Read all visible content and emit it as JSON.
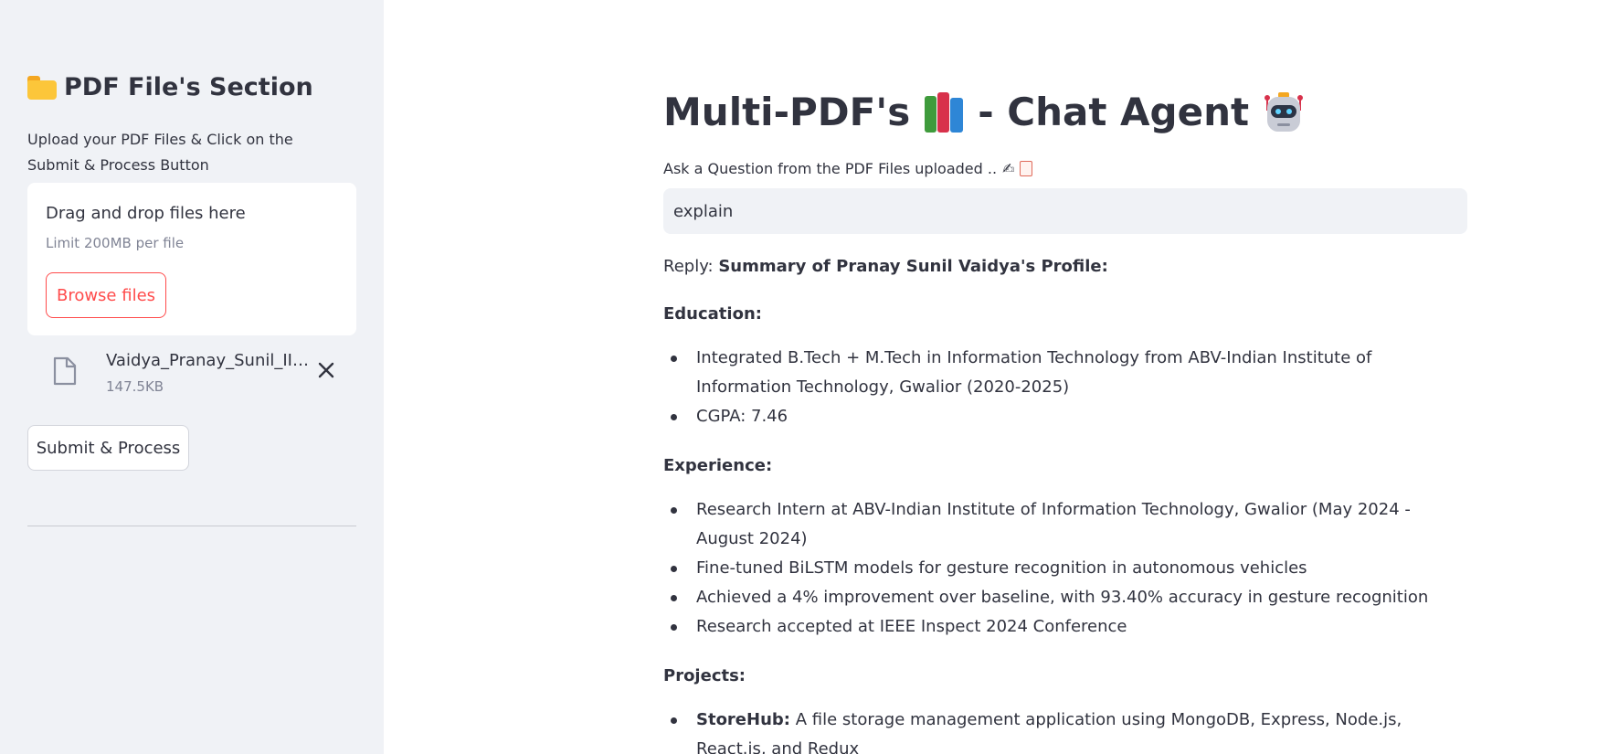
{
  "sidebar": {
    "title": "PDF File's Section",
    "description": "Upload your PDF Files & Click on the Submit & Process Button",
    "uploader": {
      "drag_text": "Drag and drop files here",
      "limit_text": "Limit 200MB per file",
      "browse_label": "Browse files"
    },
    "file": {
      "name": "Vaidya_Pranay_Sunil_III...",
      "size": "147.5KB"
    },
    "submit_label": "Submit & Process"
  },
  "main": {
    "title_part1": "Multi-PDF's",
    "title_part2": "- Chat Agent",
    "ask_label": "Ask a Question from the PDF Files uploaded ..",
    "input_value": "explain",
    "reply_prefix": "Reply:",
    "reply_heading": "Summary of Pranay Sunil Vaidya's Profile:",
    "sections": {
      "education": {
        "heading": "Education:",
        "items": [
          "Integrated B.Tech + M.Tech in Information Technology from ABV-Indian Institute of Information Technology, Gwalior (2020-2025)",
          "CGPA: 7.46"
        ]
      },
      "experience": {
        "heading": "Experience:",
        "items": [
          "Research Intern at ABV-Indian Institute of Information Technology, Gwalior (May 2024 - August 2024)",
          "Fine-tuned BiLSTM models for gesture recognition in autonomous vehicles",
          "Achieved a 4% improvement over baseline, with 93.40% accuracy in gesture recognition",
          "Research accepted at IEEE Inspect 2024 Conference"
        ]
      },
      "projects": {
        "heading": "Projects:",
        "items": [
          {
            "name": "StoreHub:",
            "text": "A file storage management application using MongoDB, Express, Node.js, React.js, and Redux"
          }
        ]
      }
    }
  },
  "colors": {
    "sidebar_bg": "#f0f2f6",
    "accent": "#ff4b4b",
    "text": "#31333f",
    "muted": "#808495"
  }
}
